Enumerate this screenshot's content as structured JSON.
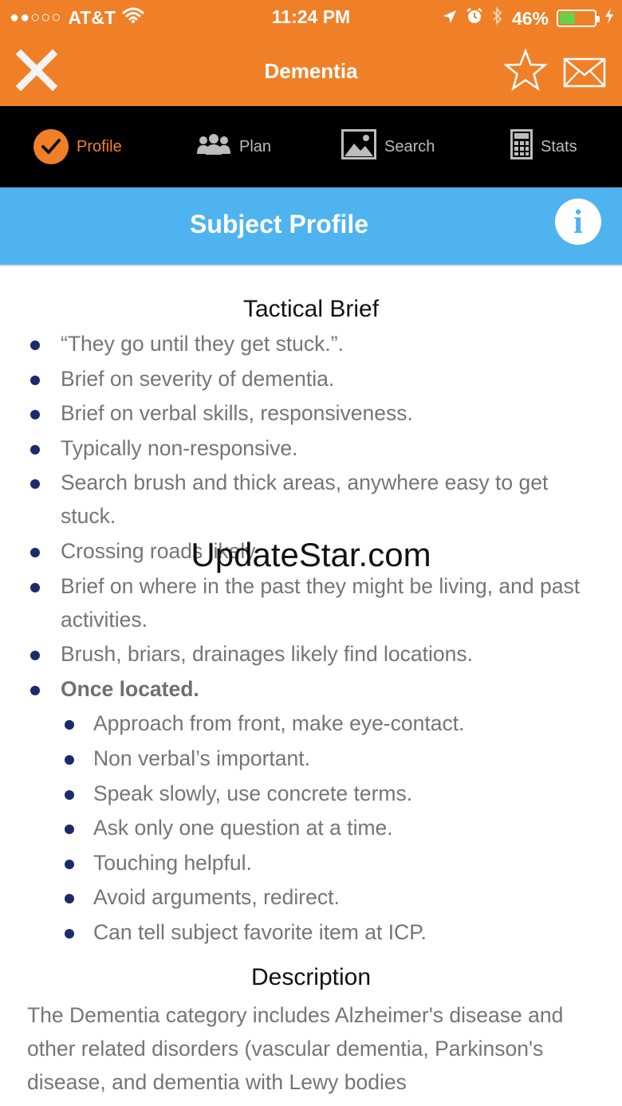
{
  "status_bar": {
    "signal": "●●○○○",
    "carrier": "AT&T",
    "time": "11:24 PM",
    "battery_percent": "46%",
    "battery_level": 0.46
  },
  "nav": {
    "title": "Dementia"
  },
  "tabs": [
    {
      "label": "Profile",
      "active": true
    },
    {
      "label": "Plan",
      "active": false
    },
    {
      "label": "Search",
      "active": false
    },
    {
      "label": "Stats",
      "active": false
    }
  ],
  "section": {
    "title": "Subject Profile",
    "info_glyph": "i"
  },
  "tactical_brief": {
    "heading": "Tactical Brief",
    "items": [
      "“They go until they get stuck.”.",
      "Brief on severity of dementia.",
      "Brief on verbal skills, responsiveness.",
      "Typically non-responsive.",
      "Search brush and thick areas, anywhere easy to get stuck.",
      "Crossing roads likely.",
      "Brief on where in the past they might be living, and past activities.",
      "Brush, briars, drainages likely find locations."
    ],
    "once_located": "Once located.",
    "sub_items": [
      "Approach from front, make eye-contact.",
      "Non verbal’s important.",
      "Speak slowly, use concrete terms.",
      "Ask only one question at a time.",
      "Touching helpful.",
      "Avoid arguments, redirect.",
      "Can tell subject favorite item at ICP."
    ]
  },
  "description": {
    "heading": "Description",
    "text": "The Dementia category includes Alzheimer's disease and other related disorders (vascular dementia, Parkinson's disease, and dementia with Lewy bodies"
  },
  "watermark": "UpdateStar.com",
  "colors": {
    "header_orange": "#f08028",
    "section_blue": "#4fb3f0",
    "bullet_navy": "#1b2a6b",
    "tabbar_black": "#000000"
  }
}
